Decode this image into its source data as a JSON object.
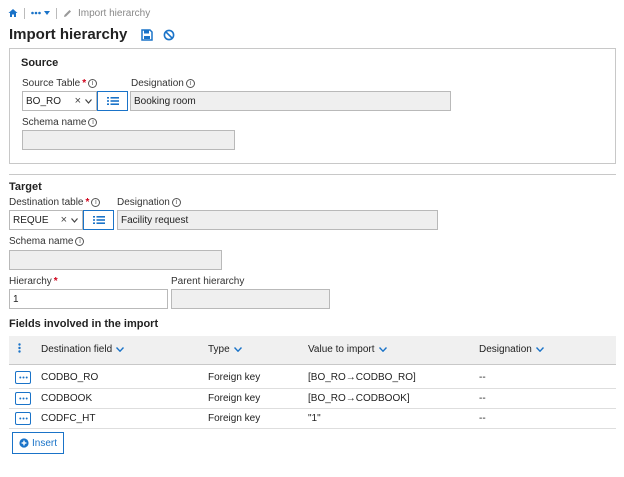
{
  "breadcrumb": {
    "current": "Import hierarchy"
  },
  "page": {
    "title": "Import hierarchy"
  },
  "source": {
    "section_title": "Source",
    "table_label": "Source Table",
    "table_value": "BO_RO",
    "designation_label": "Designation",
    "designation_value": "Booking room",
    "schema_label": "Schema name",
    "schema_value": ""
  },
  "target": {
    "section_title": "Target",
    "table_label": "Destination table",
    "table_value": "REQUE",
    "designation_label": "Designation",
    "designation_value": "Facility request",
    "schema_label": "Schema name",
    "schema_value": "",
    "hierarchy_label": "Hierarchy",
    "hierarchy_value": "1",
    "parent_label": "Parent hierarchy",
    "parent_value": ""
  },
  "fields": {
    "title": "Fields involved in the import",
    "columns": [
      "Destination field",
      "Type",
      "Value to import",
      "Designation"
    ],
    "rows": [
      {
        "dest": "CODBO_RO",
        "type": "Foreign key",
        "value": "[BO_RO→CODBO_RO]",
        "designation": "--"
      },
      {
        "dest": "CODBOOK",
        "type": "Foreign key",
        "value": "[BO_RO→CODBOOK]",
        "designation": "--"
      },
      {
        "dest": "CODFC_HT",
        "type": "Foreign key",
        "value": "\"1\"",
        "designation": "--"
      }
    ],
    "insert_label": "Insert"
  },
  "colors": {
    "accent": "#1a73c8",
    "required": "#d0021b"
  },
  "icons": [
    "home-icon",
    "more-icon",
    "pencil-icon",
    "save-icon",
    "cancel-icon",
    "info-icon",
    "clear-icon",
    "chevron-down-icon",
    "list-icon",
    "plus-circle-icon"
  ]
}
